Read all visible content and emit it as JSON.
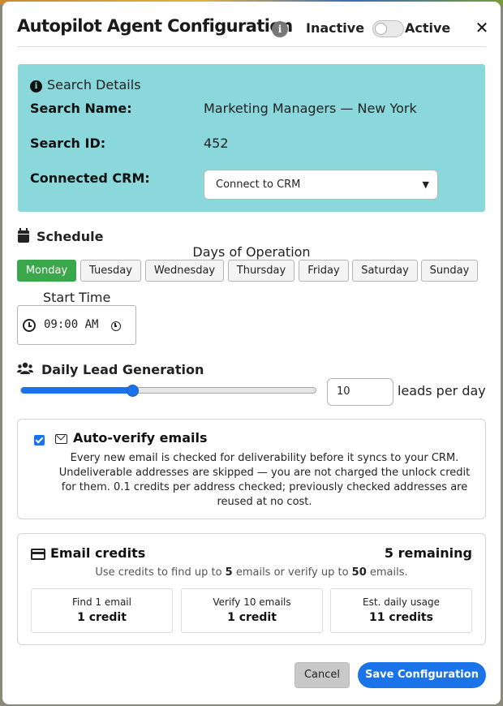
{
  "header": {
    "title": "Autopilot Agent Configuration",
    "info_icon": "info-icon",
    "toggle": {
      "off_label": "Inactive",
      "on_label": "Active",
      "state": "off"
    },
    "close_label": "✕"
  },
  "search_details": {
    "heading": "Search Details",
    "name_label": "Search Name:",
    "name_value": "Marketing Managers — New York",
    "id_label": "Search ID:",
    "id_value": "452",
    "crm_label": "Connected CRM:",
    "crm_selected": "Connect to CRM",
    "background_color": "#8ad8dc"
  },
  "schedule": {
    "heading": "Schedule",
    "days_caption": "Days of Operation",
    "days": [
      {
        "label": "Monday",
        "selected": true
      },
      {
        "label": "Tuesday",
        "selected": false
      },
      {
        "label": "Wednesday",
        "selected": false
      },
      {
        "label": "Thursday",
        "selected": false
      },
      {
        "label": "Friday",
        "selected": false
      },
      {
        "label": "Saturday",
        "selected": false
      },
      {
        "label": "Sunday",
        "selected": false
      }
    ],
    "start_caption": "Start Time",
    "start_time": "09:00 AM",
    "selected_color": "#3aa74a"
  },
  "lead_generation": {
    "heading": "Daily Lead Generation",
    "slider_fraction": 0.38,
    "value": "10",
    "unit": "leads per day",
    "accent_color": "#1a73e8"
  },
  "auto_verify": {
    "checked": true,
    "title": "Auto-verify emails",
    "description": "Every new email is checked for deliverability before it syncs to your CRM. Undeliverable addresses are skipped — you are not charged the unlock credit for them. 0.1 credits per address checked; previously checked addresses are reused at no cost."
  },
  "email_credits": {
    "title": "Email credits",
    "remaining": "5 remaining",
    "hint_prefix": "Use credits to find up to ",
    "hint_find": "5",
    "hint_middle": " emails or verify up to ",
    "hint_verify": "50",
    "hint_suffix": " emails.",
    "cards": [
      {
        "label": "Find 1 email",
        "value": "1 credit"
      },
      {
        "label": "Verify 10 emails",
        "value": "1 credit"
      },
      {
        "label": "Est. daily usage",
        "value": "11 credits"
      }
    ]
  },
  "footer": {
    "cancel_label": "Cancel",
    "save_label": "Save Configuration"
  }
}
